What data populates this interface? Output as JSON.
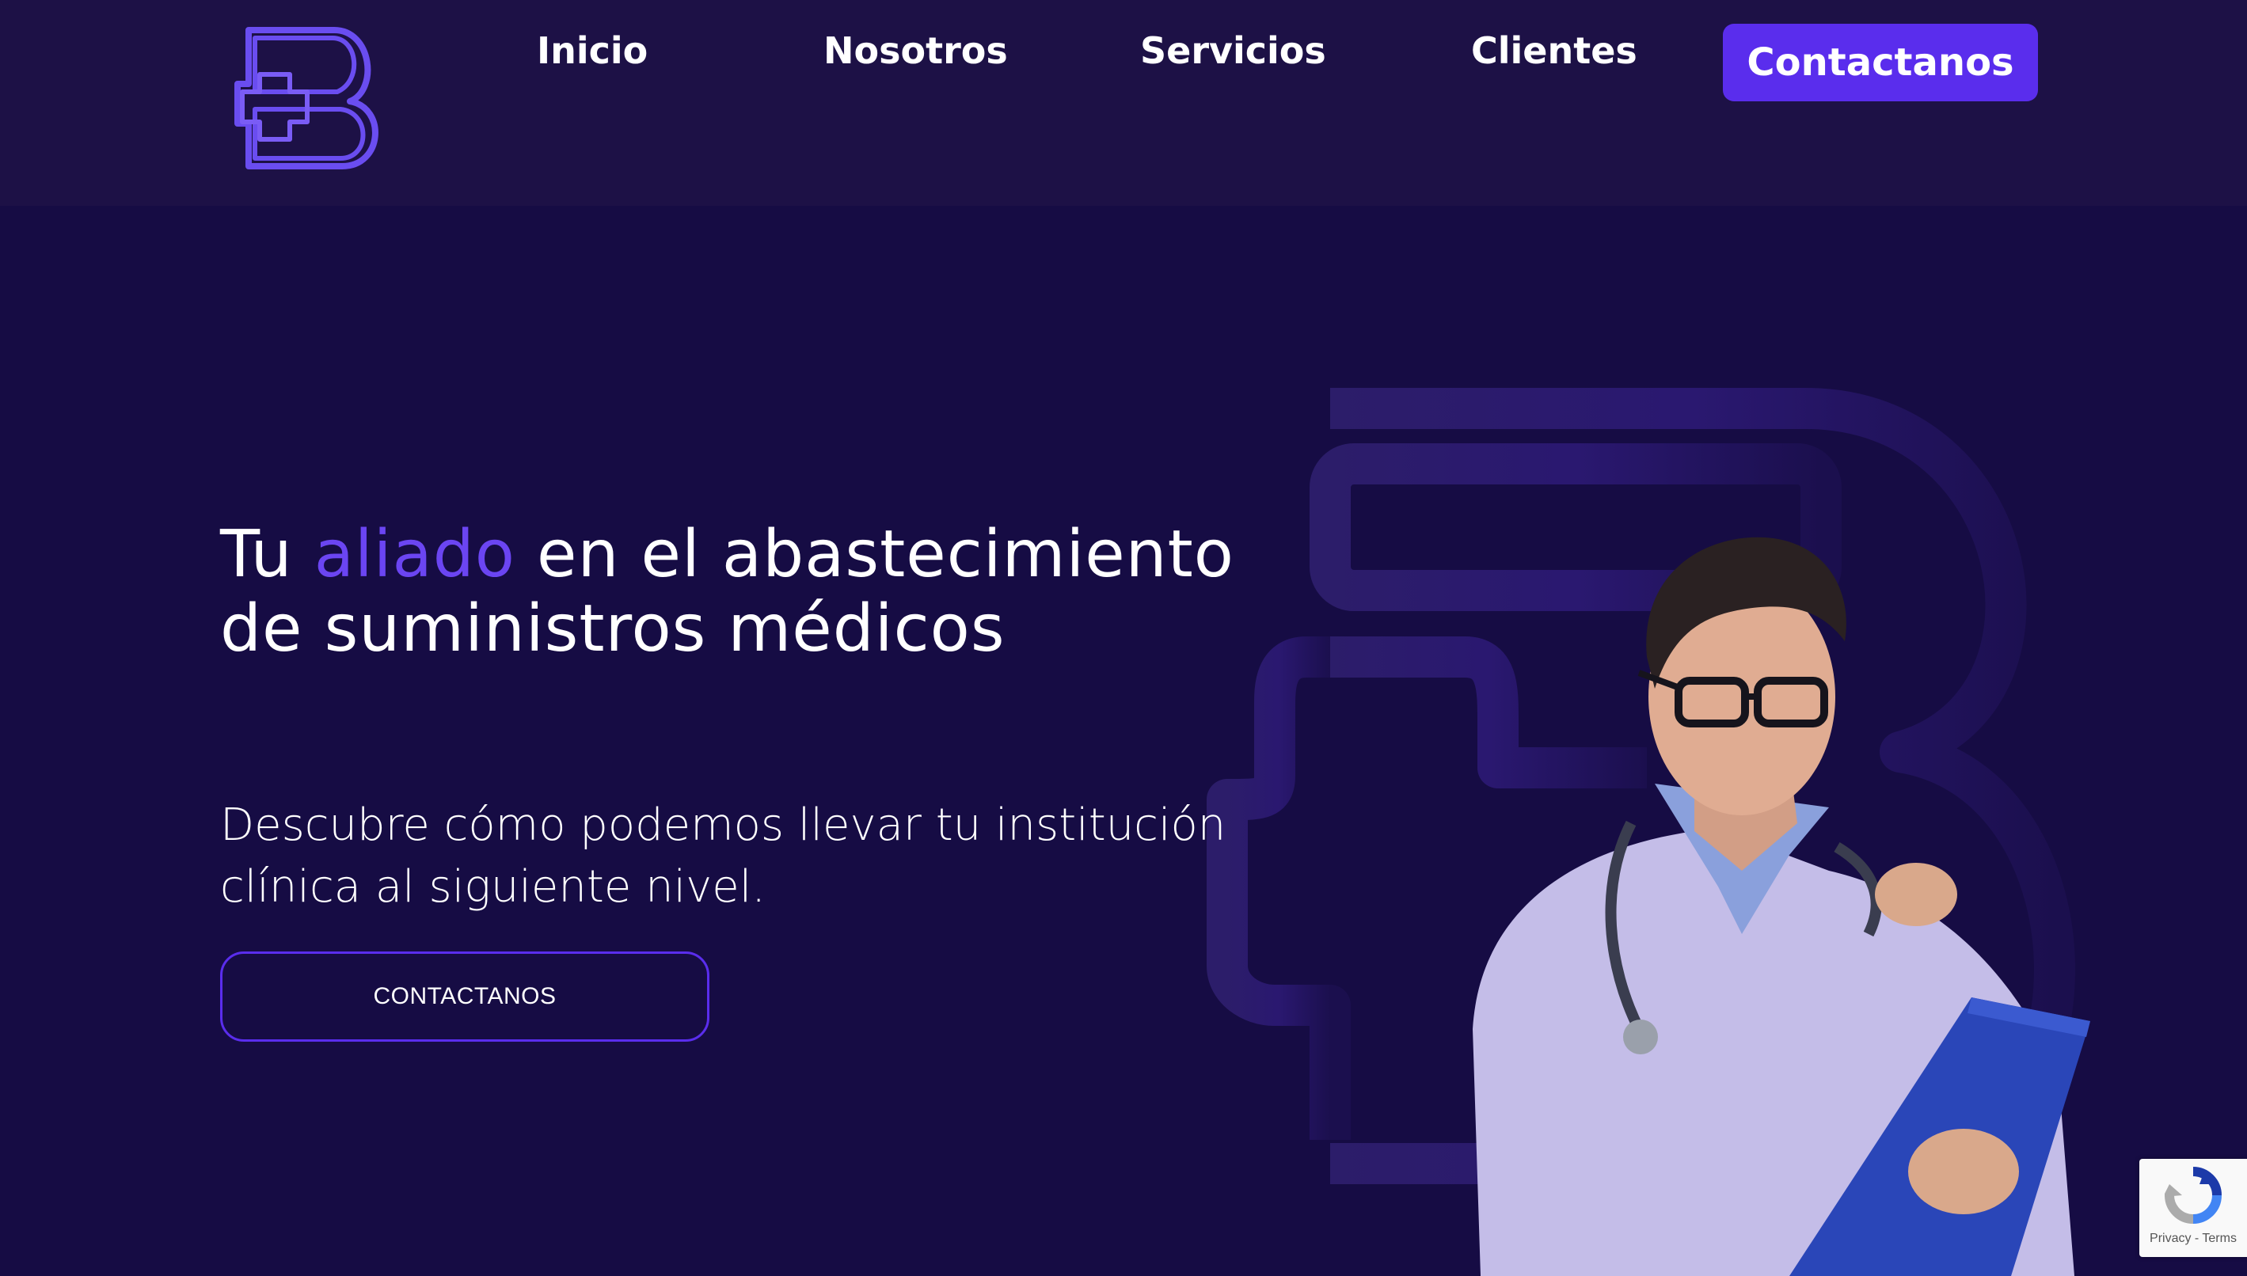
{
  "header": {
    "logo_alt": "b-plus-logo",
    "nav": {
      "inicio": "Inicio",
      "nosotros": "Nosotros",
      "servicios": "Servicios",
      "clientes": "Clientes"
    },
    "cta_label": "Contactanos"
  },
  "hero": {
    "title_part1": "Tu ",
    "title_accent": "aliado",
    "title_part2": " en el abastecimiento de suministros médicos",
    "subtitle": "Descubre cómo podemos llevar tu institución clínica al siguiente nivel.",
    "button_label": "CONTACTANOS"
  },
  "recaptcha": {
    "privacy": "Privacy",
    "separator": " - ",
    "terms": "Terms"
  },
  "colors": {
    "background": "#160c44",
    "header": "#1d1146",
    "accent": "#5a2ded",
    "accent_text": "#6b45f2",
    "logo_stroke": "#6a4df0"
  }
}
